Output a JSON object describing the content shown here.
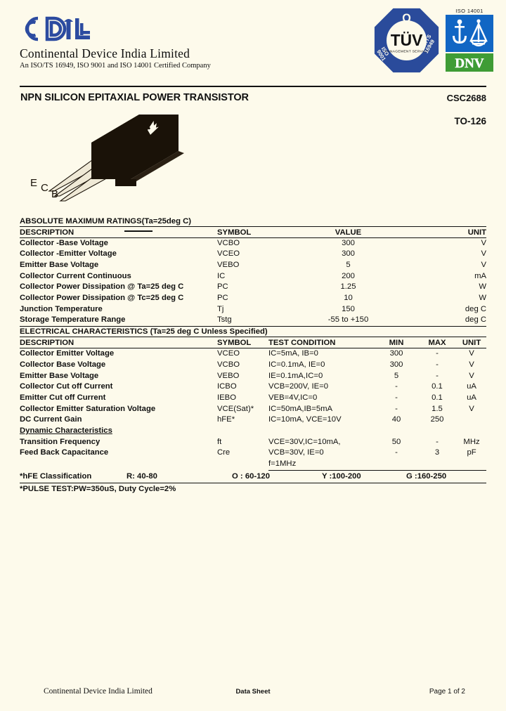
{
  "header": {
    "logo_text": "CDIL",
    "logo_icon": "cdil-logo",
    "company_name": "Continental Device India Limited",
    "company_iso_line": "An ISO/TS 16949, ISO 9001 and ISO 14001 Certified Company",
    "certs": {
      "tuv": {
        "mark": "TÜV",
        "subtitle": "MANAGEMENT SERVICE",
        "left_text": "ISO 9001",
        "right_text": "ISO/TS 16949",
        "top_glyph": "Q",
        "color": "#2a4b9b"
      },
      "dnv": {
        "iso_label": "ISO 14001",
        "wordmark": "DNV",
        "blue": "#1166c4",
        "green": "#3f9c35"
      }
    }
  },
  "title": {
    "main": "NPN SILICON EPITAXIAL POWER TRANSISTOR",
    "part_number": "CSC2688",
    "package": "TO-126"
  },
  "package_drawing": {
    "lead_labels": [
      "E",
      "C",
      "B"
    ],
    "body_color": "#1a1208"
  },
  "abs_max": {
    "section_title": "ABSOLUTE MAXIMUM RATINGS(Ta=25deg C)",
    "columns": [
      "DESCRIPTION",
      "SYMBOL",
      "VALUE",
      "UNIT"
    ],
    "rows": [
      {
        "description": "Collector -Base Voltage",
        "symbol": "VCBO",
        "value": "300",
        "unit": "V"
      },
      {
        "description": "Collector -Emitter Voltage",
        "symbol": "VCEO",
        "value": "300",
        "unit": "V"
      },
      {
        "description": "Emitter Base Voltage",
        "symbol": "VEBO",
        "value": "5",
        "unit": "V"
      },
      {
        "description": "Collector Current Continuous",
        "symbol": "IC",
        "value": "200",
        "unit": "mA"
      },
      {
        "description": "Collector Power Dissipation @ Ta=25 deg C",
        "symbol": "PC",
        "value": "1.25",
        "unit": "W"
      },
      {
        "description": "Collector Power Dissipation @ Tc=25 deg C",
        "symbol": "PC",
        "value": "10",
        "unit": "W"
      },
      {
        "description": "Junction Temperature",
        "symbol": "Tj",
        "value": "150",
        "unit": "deg C"
      },
      {
        "description": "Storage Temperature Range",
        "symbol": "Tstg",
        "value": "-55 to +150",
        "unit": "deg C"
      }
    ]
  },
  "elec_char": {
    "section_title": "ELECTRICAL CHARACTERISTICS (Ta=25 deg C Unless Specified)",
    "columns": [
      "DESCRIPTION",
      "SYMBOL",
      "TEST CONDITION",
      "MIN",
      "MAX",
      "UNIT"
    ],
    "rows": [
      {
        "description": "Collector Emitter Voltage",
        "symbol": "VCEO",
        "test": "IC=5mA, IB=0",
        "min": "300",
        "max": "-",
        "unit": "V"
      },
      {
        "description": "Collector Base Voltage",
        "symbol": "VCBO",
        "test": "IC=0.1mA, IE=0",
        "min": "300",
        "max": "-",
        "unit": "V"
      },
      {
        "description": "Emitter Base Voltage",
        "symbol": "VEBO",
        "test": "IE=0.1mA,IC=0",
        "min": "5",
        "max": "-",
        "unit": "V"
      },
      {
        "description": "Collector Cut off Current",
        "symbol": "ICBO",
        "test": "VCB=200V, IE=0",
        "min": "-",
        "max": "0.1",
        "unit": "uA"
      },
      {
        "description": "Emitter Cut off Current",
        "symbol": "IEBO",
        "test": "VEB=4V,IC=0",
        "min": "-",
        "max": "0.1",
        "unit": "uA"
      },
      {
        "description": "Collector Emitter Saturation Voltage",
        "symbol": "VCE(Sat)*",
        "test": "IC=50mA,IB=5mA",
        "min": "-",
        "max": "1.5",
        "unit": "V"
      },
      {
        "description": "DC Current Gain",
        "symbol": "hFE*",
        "test": "IC=10mA, VCE=10V",
        "min": "40",
        "max": "250",
        "unit": ""
      }
    ],
    "dynamic_heading": "Dynamic Characteristics",
    "dynamic_rows": [
      {
        "description": "Transition Frequency",
        "symbol": "ft",
        "test": "VCE=30V,IC=10mA,",
        "min": "50",
        "max": "-",
        "unit": "MHz"
      },
      {
        "description": "Feed Back Capacitance",
        "symbol": "Cre",
        "test": "VCB=30V, IE=0",
        "min": "-",
        "max": "3",
        "unit": "pF"
      },
      {
        "description": "",
        "symbol": "",
        "test": "f=1MHz",
        "min": "",
        "max": "",
        "unit": ""
      }
    ]
  },
  "notes": {
    "hfe_label": "*hFE Classification",
    "hfe_classes": [
      "R:  40-80",
      "O : 60-120",
      "Y :100-200",
      "G :160-250"
    ],
    "pulse_test": "*PULSE TEST:PW=350uS, Duty Cycle=2%"
  },
  "footer": {
    "left": "Continental Device India Limited",
    "center": "Data Sheet",
    "right": "Page 1 of 2"
  }
}
